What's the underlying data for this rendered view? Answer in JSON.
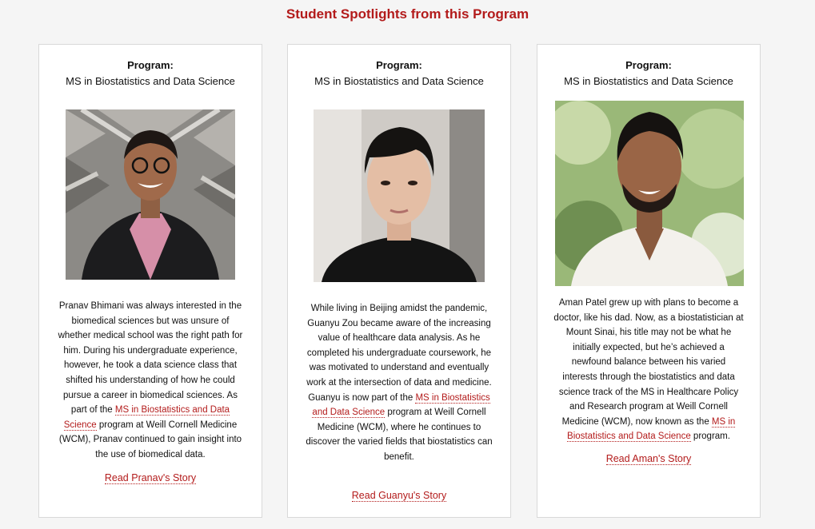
{
  "section_title": "Student Spotlights from this Program",
  "cards": [
    {
      "program_label": "Program:",
      "program_name": "MS in Biostatistics and Data Science",
      "story_before": "Pranav Bhimani was always interested in the biomedical sciences but was unsure of whether medical school was the right path for him. During his undergraduate experience, however, he took a data science class that shifted his understanding of how he could pursue a career in biomedical sciences. As part of the ",
      "story_link": "MS in Biostatistics and Data Science",
      "story_after": " program at Weill Cornell Medicine (WCM), Pranav continued to gain insight into the use of biomedical data.",
      "read_link": "Read Pranav's Story",
      "photo_alt": "Pranav Bhimani"
    },
    {
      "program_label": "Program:",
      "program_name": "MS in Biostatistics and Data Science",
      "story_before": "While living in Beijing amidst the pandemic, Guanyu Zou became aware of the increasing value of healthcare data analysis. As he completed his undergraduate coursework, he was motivated to understand and eventually work at the intersection of data and medicine. Guanyu is now part of the ",
      "story_link": "MS in Biostatistics and Data Science",
      "story_after": " program at Weill Cornell Medicine (WCM), where he continues to discover the varied fields that biostatistics can benefit.",
      "read_link": "Read Guanyu's Story",
      "photo_alt": "Guanyu Zou"
    },
    {
      "program_label": "Program:",
      "program_name": "MS in Biostatistics and Data Science",
      "story_before": "Aman Patel grew up with plans to become a doctor, like his dad. Now, as a biostatistician at Mount Sinai, his title may not be what he initially expected, but he’s achieved a newfound balance between his varied interests through the biostatistics and data science track of the MS in Healthcare Policy and Research program at Weill Cornell Medicine (WCM), now known as the ",
      "story_link": "MS in Biostatistics and Data Science",
      "story_after": " program.",
      "read_link": "Read Aman's Story",
      "photo_alt": "Aman Patel"
    }
  ],
  "colors": {
    "accent": "#b31b1b",
    "card_bg": "#ffffff",
    "page_bg": "#f5f5f5"
  }
}
